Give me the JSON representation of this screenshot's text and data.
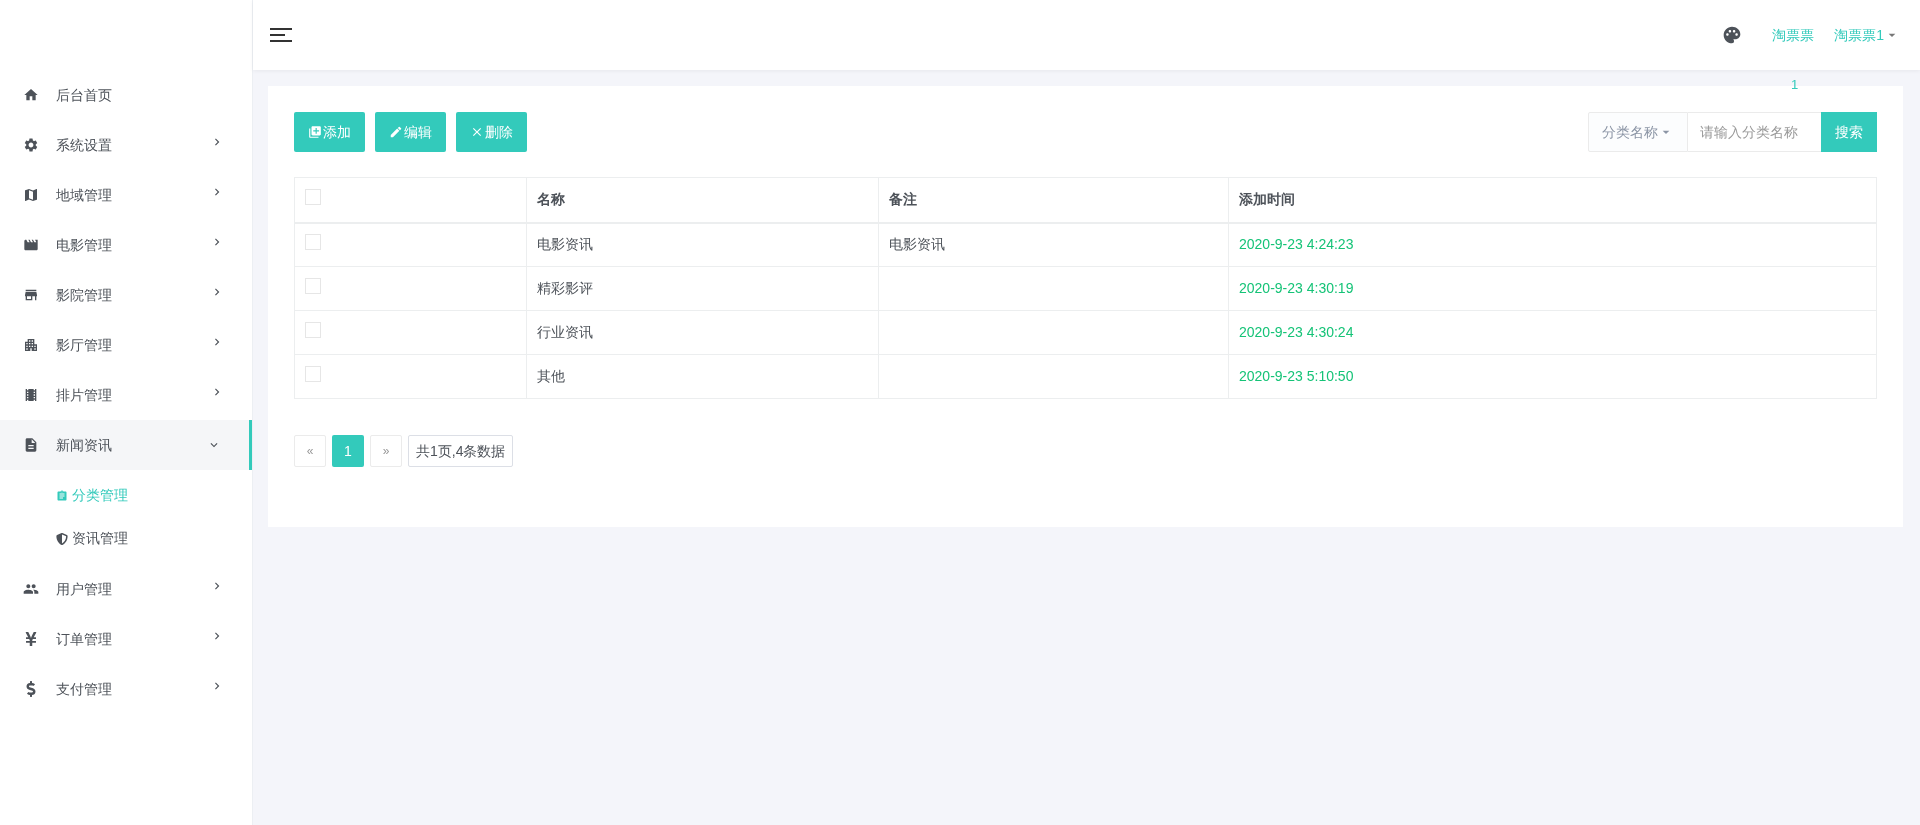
{
  "header": {
    "theme_badge": "1",
    "links": [
      {
        "label": "淘票票",
        "kind": "link"
      },
      {
        "label": "淘票票1",
        "kind": "dropdown"
      }
    ]
  },
  "sidebar": {
    "items": [
      {
        "label": "后台首页",
        "selected": false
      },
      {
        "label": "系统设置",
        "expanded": false,
        "selected": false
      },
      {
        "label": "地域管理",
        "expanded": false,
        "selected": false
      },
      {
        "label": "电影管理",
        "expanded": false,
        "selected": false
      },
      {
        "label": "影院管理",
        "expanded": false,
        "selected": false
      },
      {
        "label": "影厅管理",
        "expanded": false,
        "selected": false
      },
      {
        "label": "排片管理",
        "expanded": false,
        "selected": false
      },
      {
        "label": "新闻资讯",
        "expanded": true,
        "selected": true,
        "children": [
          {
            "label": "分类管理",
            "selected": true
          },
          {
            "label": "资讯管理",
            "selected": false
          }
        ]
      },
      {
        "label": "用户管理",
        "expanded": false,
        "selected": false
      },
      {
        "label": "订单管理",
        "expanded": false,
        "selected": false
      },
      {
        "label": "支付管理",
        "expanded": false,
        "selected": false
      }
    ]
  },
  "toolbar": {
    "buttons": [
      {
        "label": "添加",
        "kind": "add"
      },
      {
        "label": "编辑",
        "kind": "edit"
      },
      {
        "label": "删除",
        "kind": "delete"
      }
    ],
    "search": {
      "filter": "分类名称",
      "placeholder": "请输入分类名称",
      "button": "搜索"
    }
  },
  "table": {
    "header_checked": false,
    "columns": [
      "名称",
      "备注",
      "添加时间"
    ],
    "rows": [
      {
        "checked": false,
        "cells": [
          "电影资讯",
          "电影资讯",
          "2020-9-23 4:24:23"
        ]
      },
      {
        "checked": false,
        "cells": [
          "精彩影评",
          "",
          "2020-9-23 4:30:19"
        ]
      },
      {
        "checked": false,
        "cells": [
          "行业资讯",
          "",
          "2020-9-23 4:30:24"
        ]
      },
      {
        "checked": false,
        "cells": [
          "其他",
          "",
          "2020-9-23 5:10:50"
        ]
      }
    ]
  },
  "pagination": {
    "prev": "«",
    "pages": [
      {
        "label": "1",
        "selected": true
      }
    ],
    "next": "»",
    "summary": "共1页,4条数据"
  }
}
